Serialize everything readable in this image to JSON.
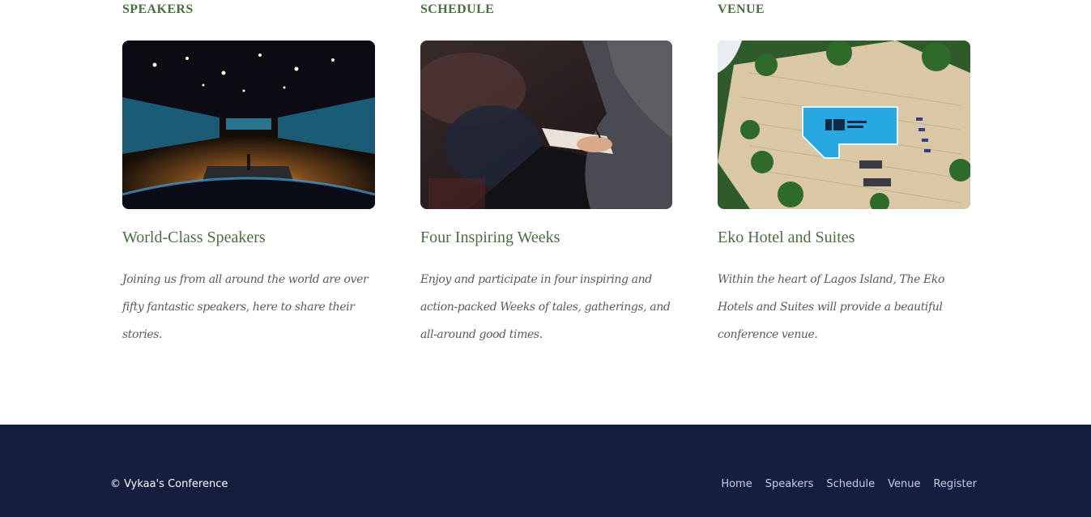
{
  "features": [
    {
      "eyebrow": "SPEAKERS",
      "title": "World-Class Speakers",
      "text": "Joining us from all around the world are over fifty fantastic speakers, here to share their stories."
    },
    {
      "eyebrow": "SCHEDULE",
      "title": "Four Inspiring Weeks",
      "text": "Enjoy and participate in four inspiring and action-packed Weeks of tales, gatherings, and all-around good times."
    },
    {
      "eyebrow": "VENUE",
      "title": "Eko Hotel and Suites",
      "text": "Within the heart of Lagos Island, The Eko Hotels and Suites will provide a beautiful conference venue."
    }
  ],
  "footer": {
    "copyright": "© Vykaa's Conference",
    "nav": [
      "Home",
      "Speakers",
      "Schedule",
      "Venue",
      "Register"
    ]
  },
  "colors": {
    "accent_green": "#4a7040",
    "footer_bg": "#161e40",
    "body_text": "#5a5a66"
  }
}
